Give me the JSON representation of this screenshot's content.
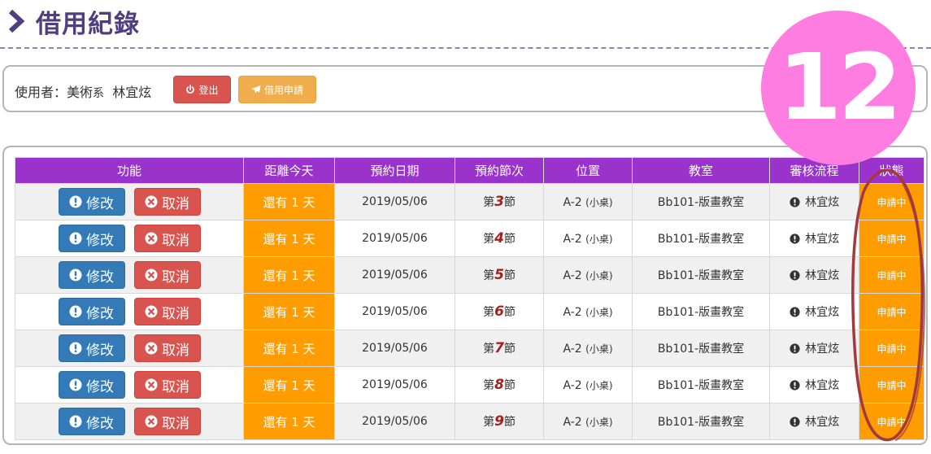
{
  "page": {
    "title": "借用紀錄"
  },
  "user_bar": {
    "user_prefix": "使用者：美術",
    "user_dept_suffix": "系",
    "user_name": "林宜炫",
    "logout_label": "登出",
    "apply_label": "借用申請"
  },
  "badge": {
    "number": "12"
  },
  "table": {
    "headers": {
      "actions": "功能",
      "countdown": "距離今天",
      "date": "預約日期",
      "period": "預約節次",
      "seat": "位置",
      "room": "教室",
      "review": "審核流程",
      "status": "狀態"
    },
    "rows": [
      {
        "edit": "修改",
        "cancel": "取消",
        "countdown": "還有 1 天",
        "date": "2019/05/06",
        "period_prefix": "第",
        "period_num": "3",
        "period_suffix": "節",
        "seat_code": "A-2",
        "seat_type": "(小桌)",
        "room": "Bb101-版畫教室",
        "reviewer": "林宜炫",
        "status": "申請中"
      },
      {
        "edit": "修改",
        "cancel": "取消",
        "countdown": "還有 1 天",
        "date": "2019/05/06",
        "period_prefix": "第",
        "period_num": "4",
        "period_suffix": "節",
        "seat_code": "A-2",
        "seat_type": "(小桌)",
        "room": "Bb101-版畫教室",
        "reviewer": "林宜炫",
        "status": "申請中"
      },
      {
        "edit": "修改",
        "cancel": "取消",
        "countdown": "還有 1 天",
        "date": "2019/05/06",
        "period_prefix": "第",
        "period_num": "5",
        "period_suffix": "節",
        "seat_code": "A-2",
        "seat_type": "(小桌)",
        "room": "Bb101-版畫教室",
        "reviewer": "林宜炫",
        "status": "申請中"
      },
      {
        "edit": "修改",
        "cancel": "取消",
        "countdown": "還有 1 天",
        "date": "2019/05/06",
        "period_prefix": "第",
        "period_num": "6",
        "period_suffix": "節",
        "seat_code": "A-2",
        "seat_type": "(小桌)",
        "room": "Bb101-版畫教室",
        "reviewer": "林宜炫",
        "status": "申請中"
      },
      {
        "edit": "修改",
        "cancel": "取消",
        "countdown": "還有 1 天",
        "date": "2019/05/06",
        "period_prefix": "第",
        "period_num": "7",
        "period_suffix": "節",
        "seat_code": "A-2",
        "seat_type": "(小桌)",
        "room": "Bb101-版畫教室",
        "reviewer": "林宜炫",
        "status": "申請中"
      },
      {
        "edit": "修改",
        "cancel": "取消",
        "countdown": "還有 1 天",
        "date": "2019/05/06",
        "period_prefix": "第",
        "period_num": "8",
        "period_suffix": "節",
        "seat_code": "A-2",
        "seat_type": "(小桌)",
        "room": "Bb101-版畫教室",
        "reviewer": "林宜炫",
        "status": "申請中"
      },
      {
        "edit": "修改",
        "cancel": "取消",
        "countdown": "還有 1 天",
        "date": "2019/05/06",
        "period_prefix": "第",
        "period_num": "9",
        "period_suffix": "節",
        "seat_code": "A-2",
        "seat_type": "(小桌)",
        "room": "Bb101-版畫教室",
        "reviewer": "林宜炫",
        "status": "申請中"
      }
    ]
  },
  "icons": {
    "title": "chevron-right-icon",
    "logout": "power-icon",
    "apply": "plane-icon",
    "edit": "exclamation-circle-icon",
    "cancel": "times-circle-icon",
    "review": "exclamation-circle-icon"
  },
  "colors": {
    "title": "#4e3f7e",
    "header": "#9a33cc",
    "countdown": "#ff9c00",
    "status": "#ff9c00",
    "edit_button": "#337ab7",
    "cancel_button": "#d9534f",
    "apply_button": "#f0ad4e",
    "badge": "#ff7ce0",
    "annotation": "#a2393f"
  }
}
